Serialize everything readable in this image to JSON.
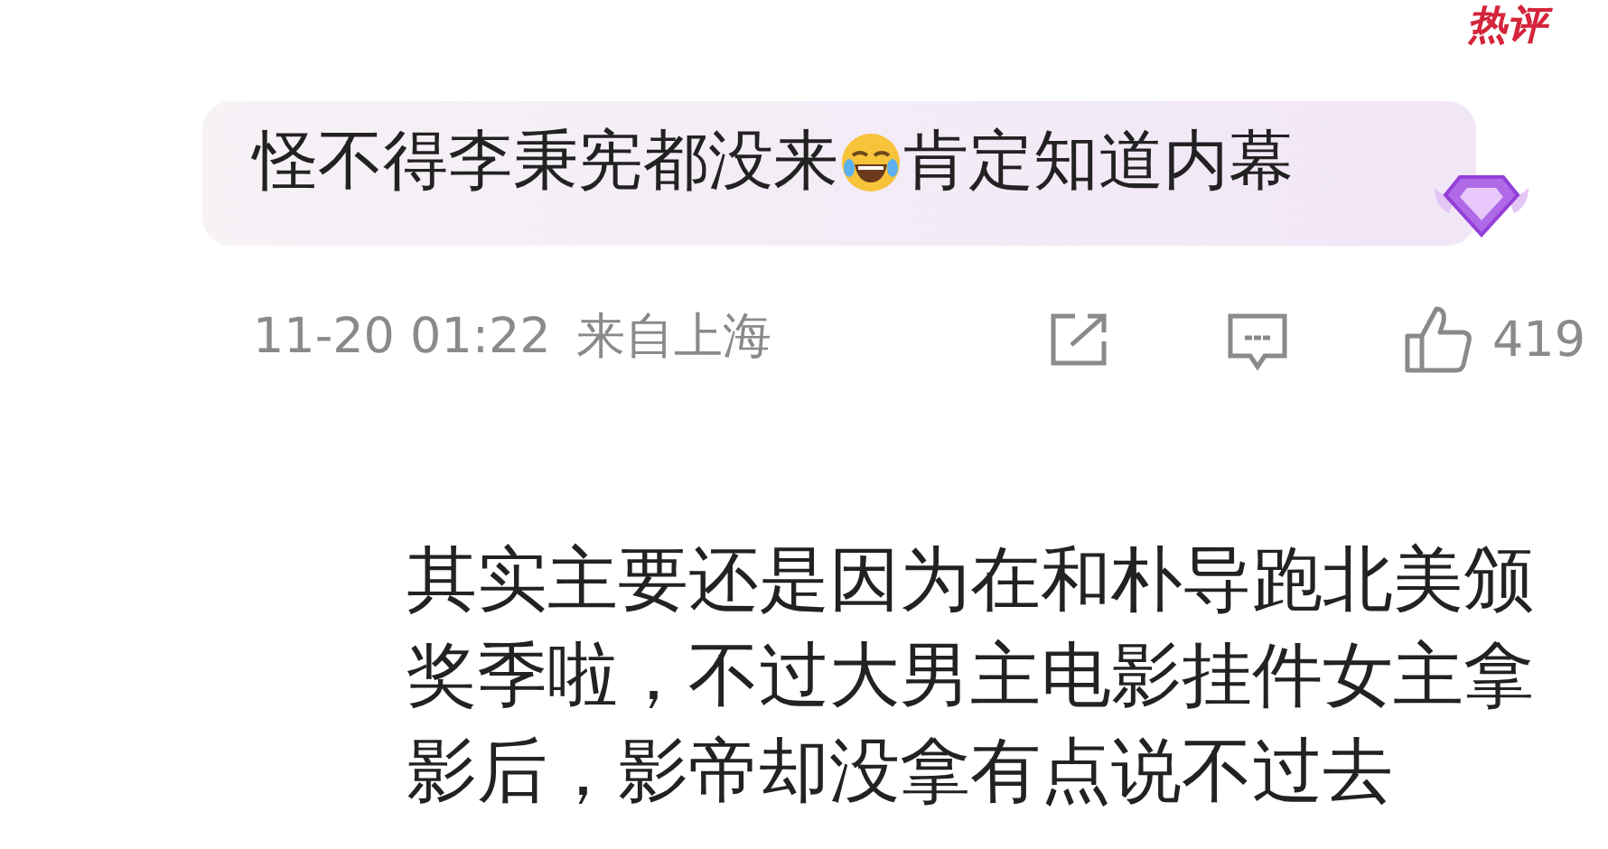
{
  "badge": "热评",
  "comment": {
    "text_before": "怪不得李秉宪都没来",
    "text_after": "肯定知道内幕"
  },
  "meta": {
    "time": "11-20 01:22",
    "location": "来自上海",
    "likes": "419"
  },
  "reply": {
    "text": "其实主要还是因为在和朴导跑北美颁奖季啦，不过大男主电影挂件女主拿影后，影帝却没拿有点说不过去"
  }
}
